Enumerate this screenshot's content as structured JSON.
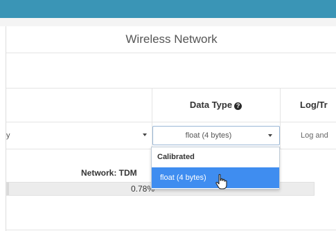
{
  "panel": {
    "title": "Wireless Network"
  },
  "table": {
    "headers": {
      "data_type": "Data Type",
      "log_truncated": "Log/Tr"
    },
    "row": {
      "left_value": "y",
      "data_type_value": "float (4 bytes)",
      "log_value": "Log and"
    }
  },
  "dropdown": {
    "group_label": "Calibrated",
    "options": [
      "float (4 bytes)"
    ],
    "highlighted_index": 0
  },
  "network": {
    "label": "Network: TDM",
    "progress_text": "0.78%",
    "progress_fraction": 0.0078
  },
  "colors": {
    "header_bar": "#3a95b6",
    "highlight": "#3f8df0",
    "help_icon": "#2a2a2a"
  },
  "icons": {
    "help": "question-circle-icon",
    "caret": "caret-down-icon",
    "cursor": "hand-pointer-icon"
  }
}
